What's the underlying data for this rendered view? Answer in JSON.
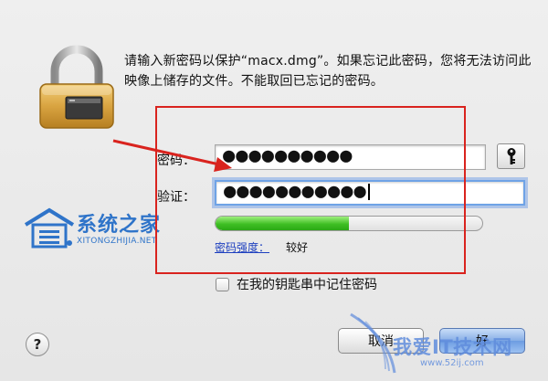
{
  "dialog": {
    "message": "请输入新密码以保护“macx.dmg”。如果忘记此密码，您将无法访问此映像上储存的文件。不能取回已忘记的密码。",
    "password_label": "密码：",
    "password_value": "●●●●●●●●●●",
    "verify_label": "验证：",
    "verify_value": "●●●●●●●●●●●",
    "strength": {
      "link_label": "密码强度：",
      "value_label": "较好",
      "level": 0.5
    },
    "keychain_label": "在我的钥匙串中记住密码",
    "keychain_checked": false,
    "buttons": {
      "help": "?",
      "cancel": "取消",
      "ok": "好"
    }
  },
  "icons": {
    "lock": "lock-icon",
    "key": "key-icon",
    "arrow": "red-arrow-annotation"
  },
  "colors": {
    "annotation_red": "#d9231e",
    "strength_green": "#3fbf24",
    "link_blue": "#1d3fbf",
    "focus_blue": "#6fa3e6",
    "watermark_blue": "#2f74c9"
  },
  "watermarks": {
    "left_title": "系统之家",
    "left_subtitle": "XITONGZHIJIA.NET",
    "right_title": "我爱IT技术网",
    "right_subtitle": "www.52ij.com"
  }
}
